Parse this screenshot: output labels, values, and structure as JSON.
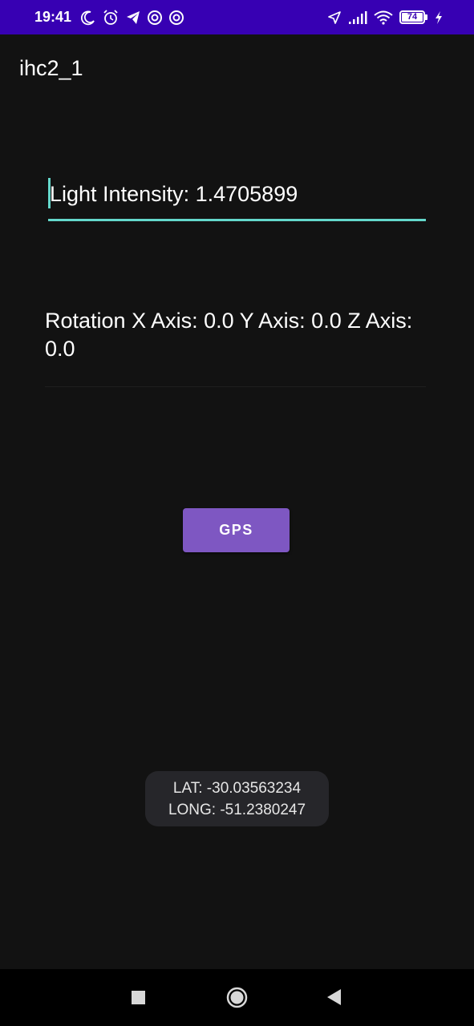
{
  "status_bar": {
    "time": "19:41",
    "battery_level": "74",
    "background_color": "#3700b3",
    "left_icons": [
      "moon-icon",
      "alarm-icon",
      "telegram-icon",
      "at-sign-icon",
      "at-sign-icon"
    ],
    "right_icons": [
      "location-icon",
      "signal-icon",
      "wifi-icon",
      "battery-icon",
      "charging-icon"
    ]
  },
  "app": {
    "title": "ihc2_1"
  },
  "main": {
    "light_intensity": "Light Intensity: 1.4705899",
    "rotation": "Rotation X Axis: 0.0 Y Axis: 0.0 Z Axis: 0.0",
    "gps_button_label": "GPS",
    "accent_color": "#64d8cb",
    "button_color": "#7e57c2"
  },
  "toast": {
    "lat": "LAT: -30.03563234",
    "long": "LONG: -51.2380247"
  },
  "nav_bar": {
    "buttons": [
      "recents-square-icon",
      "home-circle-icon",
      "back-triangle-icon"
    ]
  }
}
